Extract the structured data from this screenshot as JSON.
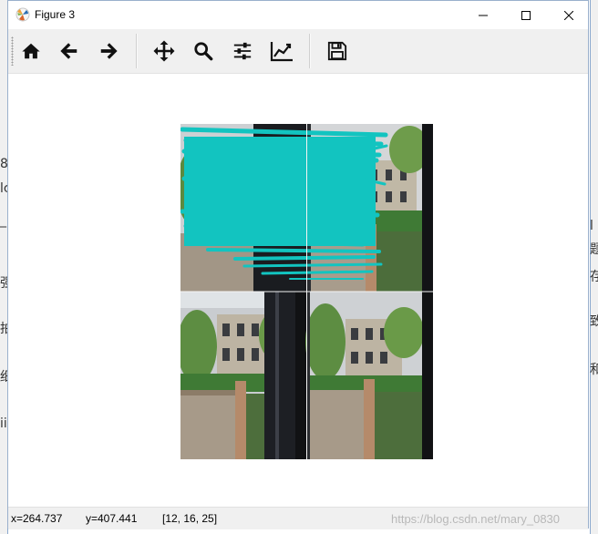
{
  "window": {
    "title": "Figure 3"
  },
  "toolbar": {
    "buttons": [
      {
        "name": "home-button",
        "icon": "home-icon"
      },
      {
        "name": "back-button",
        "icon": "arrow-left-icon"
      },
      {
        "name": "forward-button",
        "icon": "arrow-right-icon"
      },
      {
        "name": "pan-button",
        "icon": "move-icon"
      },
      {
        "name": "zoom-button",
        "icon": "magnifier-icon"
      },
      {
        "name": "subplots-button",
        "icon": "sliders-icon"
      },
      {
        "name": "axes-edit-button",
        "icon": "line-chart-icon"
      },
      {
        "name": "save-button",
        "icon": "floppy-disk-icon"
      }
    ]
  },
  "figure": {
    "panels": [
      {
        "position": "top-left",
        "content": "building photo with cyan scribble strokes"
      },
      {
        "position": "top-right",
        "content": "building photo"
      },
      {
        "position": "bottom-left",
        "content": "building photo"
      },
      {
        "position": "bottom-right",
        "content": "building photo"
      }
    ],
    "scribble_color": "#12c4c0"
  },
  "status": {
    "x": "x=264.737",
    "y": "y=407.441",
    "pixel": "[12, 16, 25]",
    "watermark": "https://blog.csdn.net/mary_0830"
  },
  "background": {
    "left_chars": [
      "8",
      "lc",
      "_",
      "强",
      "拍",
      "细",
      "ii"
    ],
    "right_chars": [
      "l",
      "题",
      "存",
      "致",
      "和"
    ]
  }
}
